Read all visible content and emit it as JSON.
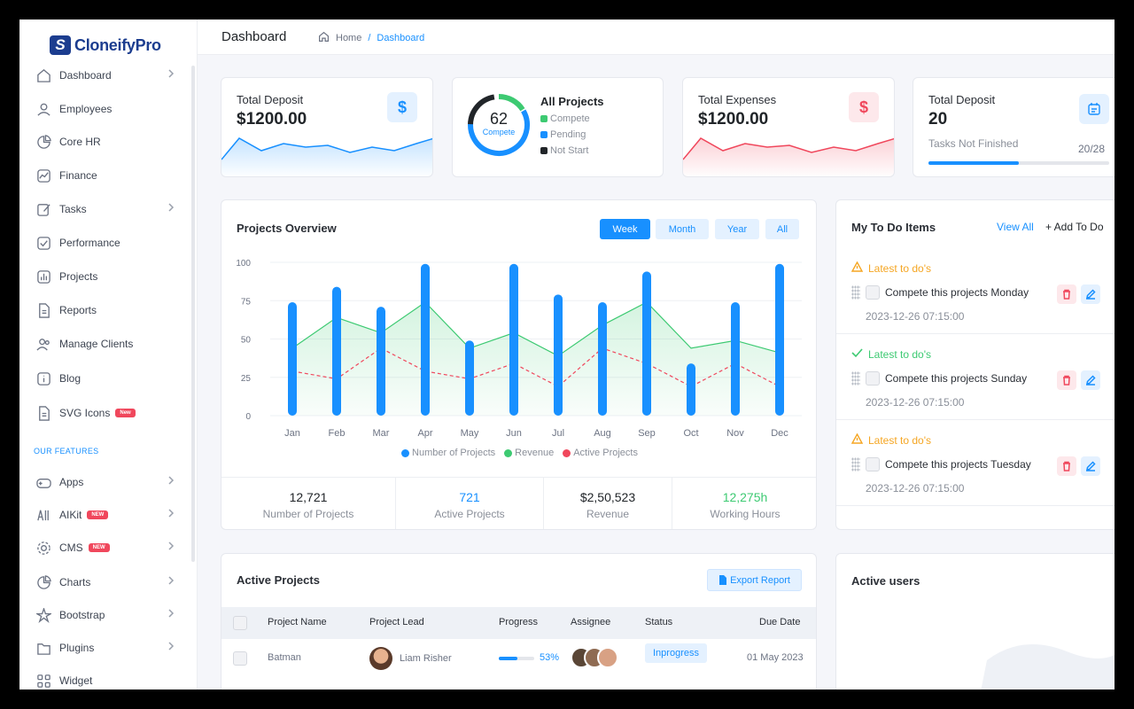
{
  "app": {
    "logo_mark": "S",
    "logo_text": "CloneifyPro"
  },
  "header": {
    "title": "Dashboard",
    "breadcrumb": {
      "home": "Home",
      "sep": "/",
      "current": "Dashboard"
    }
  },
  "sidebar": {
    "items": [
      {
        "label": "Dashboard",
        "icon": "home-icon",
        "chevron": true
      },
      {
        "label": "Employees",
        "icon": "user-icon",
        "chevron": false
      },
      {
        "label": "Core HR",
        "icon": "pie-icon",
        "chevron": false
      },
      {
        "label": "Finance",
        "icon": "chart-line-icon",
        "chevron": false
      },
      {
        "label": "Tasks",
        "icon": "edit-icon",
        "chevron": true
      },
      {
        "label": "Performance",
        "icon": "check-square-icon",
        "chevron": false
      },
      {
        "label": "Projects",
        "icon": "bar-icon",
        "chevron": false
      },
      {
        "label": "Reports",
        "icon": "file-icon",
        "chevron": false
      },
      {
        "label": "Manage Clients",
        "icon": "users-icon",
        "chevron": false
      },
      {
        "label": "Blog",
        "icon": "info-icon",
        "chevron": false
      },
      {
        "label": "SVG Icons",
        "icon": "file-icon",
        "chevron": false,
        "badge": "New"
      }
    ],
    "features_label": "OUR FEATURES",
    "feature_items": [
      {
        "label": "Apps",
        "icon": "gamepad-icon",
        "chevron": true
      },
      {
        "label": "AIKit",
        "icon": "ai-icon",
        "chevron": true,
        "badge": "NEW"
      },
      {
        "label": "CMS",
        "icon": "gear-icon",
        "chevron": true,
        "badge": "NEW"
      },
      {
        "label": "Charts",
        "icon": "pie-icon",
        "chevron": true
      },
      {
        "label": "Bootstrap",
        "icon": "star-icon",
        "chevron": true
      },
      {
        "label": "Plugins",
        "icon": "folder-icon",
        "chevron": true
      },
      {
        "label": "Widget",
        "icon": "grid-icon",
        "chevron": false
      }
    ]
  },
  "stats": {
    "deposit": {
      "label": "Total Deposit",
      "value": "$1200.00",
      "icon": "$",
      "color": "#1890ff"
    },
    "projects": {
      "title": "All Projects",
      "value": "62",
      "sub": "Compete",
      "legend": [
        "Compete",
        "Pending",
        "Not Start"
      ],
      "colors": [
        "#3dca72",
        "#1890ff",
        "#212529"
      ]
    },
    "expenses": {
      "label": "Total Expenses",
      "value": "$1200.00",
      "icon": "$",
      "color": "#f0475c"
    },
    "tasks": {
      "label": "Total Deposit",
      "value": "20",
      "sub": "Tasks Not Finished",
      "progress_text": "20/28",
      "progress": 0.5
    }
  },
  "overview": {
    "title": "Projects Overview",
    "ranges": [
      "Week",
      "Month",
      "Year",
      "All"
    ],
    "active_range": "Week",
    "kpis": [
      {
        "value": "12,721",
        "label": "Number of Projects",
        "color": "#212529"
      },
      {
        "value": "721",
        "label": "Active Projects",
        "color": "#1890ff"
      },
      {
        "value": "$2,50,523",
        "label": "Revenue",
        "color": "#212529"
      },
      {
        "value": "12,275h",
        "label": "Working Hours",
        "color": "#3dca72"
      }
    ]
  },
  "chart_data": {
    "type": "bar",
    "categories": [
      "Jan",
      "Feb",
      "Mar",
      "Apr",
      "May",
      "Jun",
      "Jul",
      "Aug",
      "Sep",
      "Oct",
      "Nov",
      "Dec"
    ],
    "series": [
      {
        "name": "Number of Projects",
        "kind": "bar",
        "color": "#1890ff",
        "values": [
          74,
          84,
          71,
          99,
          49,
          99,
          79,
          74,
          94,
          34,
          74,
          99
        ]
      },
      {
        "name": "Revenue",
        "kind": "area",
        "color": "#3dca72",
        "values": [
          44,
          64,
          54,
          74,
          44,
          54,
          39,
          59,
          74,
          44,
          49,
          41
        ]
      },
      {
        "name": "Active Projects",
        "kind": "dashed-line",
        "color": "#f0475c",
        "values": [
          29,
          24,
          44,
          29,
          24,
          34,
          19,
          44,
          34,
          19,
          34,
          19
        ]
      }
    ],
    "ylim": [
      0,
      100
    ],
    "yticks": [
      0,
      25,
      50,
      75,
      100
    ],
    "legend_position": "bottom"
  },
  "todo": {
    "title": "My To Do Items",
    "view_all": "View All",
    "add": "+ Add To Do",
    "items": [
      {
        "status": "Latest to do's",
        "state": "warning",
        "text": "Compete this projects Monday",
        "date": "2023-12-26 07:15:00"
      },
      {
        "status": "Latest to do's",
        "state": "done",
        "text": "Compete this projects Sunday",
        "date": "2023-12-26 07:15:00"
      },
      {
        "status": "Latest to do's",
        "state": "warning",
        "text": "Compete this projects Tuesday",
        "date": "2023-12-26 07:15:00"
      }
    ]
  },
  "active_projects": {
    "title": "Active Projects",
    "export": "Export Report",
    "columns": [
      "Project Name",
      "Project Lead",
      "Progress",
      "Assignee",
      "Status",
      "Due Date"
    ],
    "rows": [
      {
        "name": "Batman",
        "lead": "Liam Risher",
        "progress": "53%",
        "progress_value": 0.53,
        "status": "Inprogress",
        "due": "01 May 2023"
      }
    ]
  },
  "active_users": {
    "title": "Active users"
  }
}
